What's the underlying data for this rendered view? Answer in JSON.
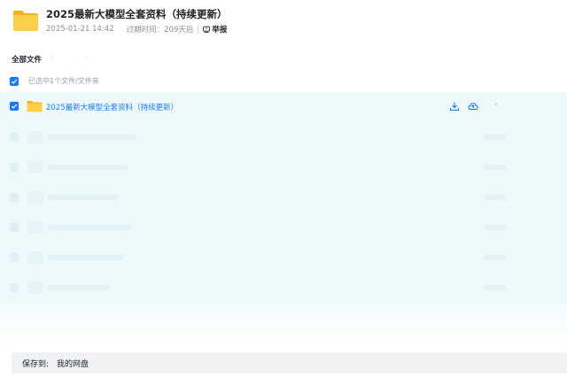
{
  "header": {
    "title": "2025最新大模型全套资料（持续更新）",
    "date": "2025-01-21 14:42",
    "expiry_label": "过期时间：",
    "expiry_value": "209天后",
    "report_label": "举报"
  },
  "breadcrumb": {
    "root": "全部文件",
    "separator": "⋮",
    "dot": "·"
  },
  "selection": {
    "text": "已选中1个文件/文件夹"
  },
  "files": [
    {
      "name": "2025最新大模型全套资料（持续更新）",
      "selected": true,
      "more_label": "-"
    }
  ],
  "save": {
    "label": "保存到:",
    "target": "我的网盘"
  },
  "colors": {
    "accent": "#1677ff",
    "folder": "#f7c32e",
    "list_bg": "#eef9fc"
  },
  "icons": [
    "folder-icon",
    "report-icon",
    "checkbox-icon",
    "download-icon",
    "cloud-save-icon",
    "more-icon"
  ]
}
